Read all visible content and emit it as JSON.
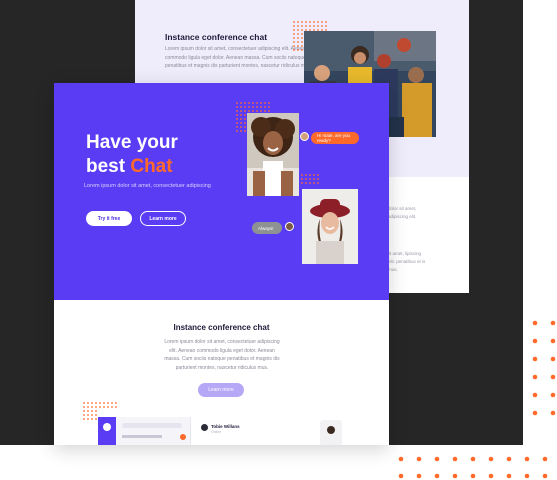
{
  "colors": {
    "dark_band": "#262626",
    "back_top": "#efedfc",
    "hero_bg": "#5b3cf5",
    "accent_orange": "#ff6a2b",
    "secondary_button": "#b7a7f7",
    "muted_text": "#8a8a9a"
  },
  "back_card": {
    "title": "Instance conference chat",
    "paragraph": "Lorem ipsum dolor sit amet, consectetuer adipiscing elit. Aenean commodo ligula eget dolor. Aenean massa. Cum sociis natoque penatibus et magnis dis parturient montes, nascetur ridiculus mus.",
    "side_text_1": "dolor sit amet, adipiscing elit.",
    "side_text_2": "lit amet, lipiscing elit. penatibus et is mus."
  },
  "hero": {
    "title_line1": "Have your",
    "title_line2_prefix": "best ",
    "title_highlight": "Chat",
    "subtitle": "Lorem ipsum dolor sit amet, consectetuer adipiscing",
    "try_button": "Try it free",
    "learn_button": "Learn more",
    "bubble_orange": "Hi mate, are you ready?",
    "bubble_grey": "Always!"
  },
  "section": {
    "title": "Instance conference chat",
    "paragraph": "Lorem ipsum dolor sit amet, consectetuer adipiscing elit. Aenean commodo ligula eget dolor. Aenean massa. Cum sociis natoque penatibus et magnis dis parturient montes, nascetur ridiculus mus.",
    "button": "Learn more"
  },
  "app_preview": {
    "contact_name": "Tobie Willans",
    "contact_status": "Online"
  }
}
